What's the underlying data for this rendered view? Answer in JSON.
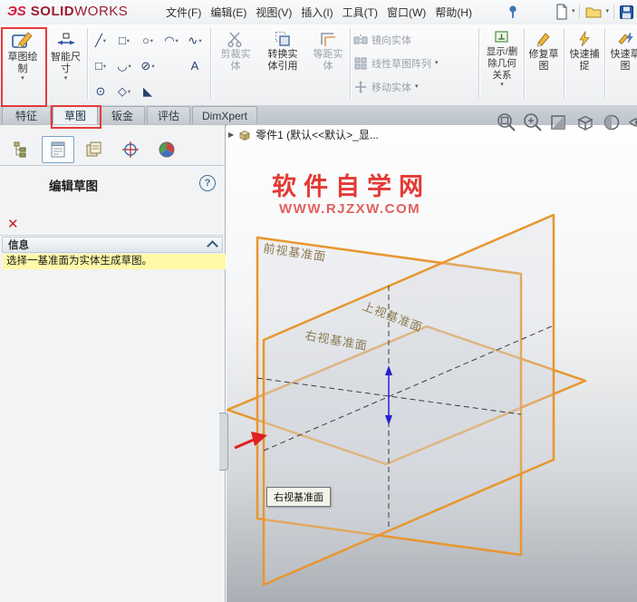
{
  "ui": {
    "dropdown_glyph": "▾"
  },
  "menubar": {
    "logo_ds": "ЭS",
    "logo_solid": "SOLID",
    "logo_works": "WORKS",
    "items": [
      "文件(F)",
      "编辑(E)",
      "视图(V)",
      "插入(I)",
      "工具(T)",
      "窗口(W)",
      "帮助(H)"
    ]
  },
  "ribbon": {
    "sketch_button": {
      "line1": "草图绘",
      "line2": "制"
    },
    "smart_dimension": {
      "line1": "智能尺",
      "line2": "寸"
    },
    "entities": {
      "row1": [
        "╱",
        "□",
        "○",
        "◠",
        "∿"
      ],
      "row2": [
        "□",
        "◡",
        "⊘",
        "A"
      ],
      "row3": [
        "⊙",
        "◇",
        "◣"
      ]
    },
    "trim": {
      "line1": "剪裁实",
      "line2": "体"
    },
    "convert": {
      "line1": "转换实",
      "line2": "体引用"
    },
    "offset": {
      "line1": "等距实",
      "line2": "体"
    },
    "mirror": "镜向实体",
    "linear_pattern": "线性草图阵列",
    "move": "移动实体",
    "relations": {
      "line1": "显示/删",
      "line2": "除几何",
      "line3": "关系"
    },
    "repair": {
      "line1": "修复草",
      "line2": "图"
    },
    "quick_snap": {
      "line1": "快速捕",
      "line2": "捉"
    },
    "rapid_sketch": {
      "line1": "快速草",
      "line2": "图"
    }
  },
  "command_tabs": [
    "特征",
    "草图",
    "钣金",
    "评估",
    "DimXpert"
  ],
  "active_tab": "草图",
  "panel": {
    "title": "编辑草图",
    "help_glyph": "?",
    "close_glyph": "✕",
    "section_header": "信息",
    "message": "选择一基准面为实体生成草图。"
  },
  "viewport": {
    "expand_glyph": "▶",
    "breadcrumb": "零件1 (默认<<默认>_显...",
    "watermark_line1": "软件自学网",
    "watermark_line2": "WWW.RJZXW.COM",
    "planes": {
      "front": "前视基准面",
      "top": "上视基准面",
      "right": "右视基准面"
    },
    "tooltip": "右视基准面"
  },
  "colors": {
    "plane_highlight": "#E8962E",
    "annotation": "#E43B3B",
    "watermark": "#E33A35",
    "message_bg": "#FFF9A8"
  }
}
